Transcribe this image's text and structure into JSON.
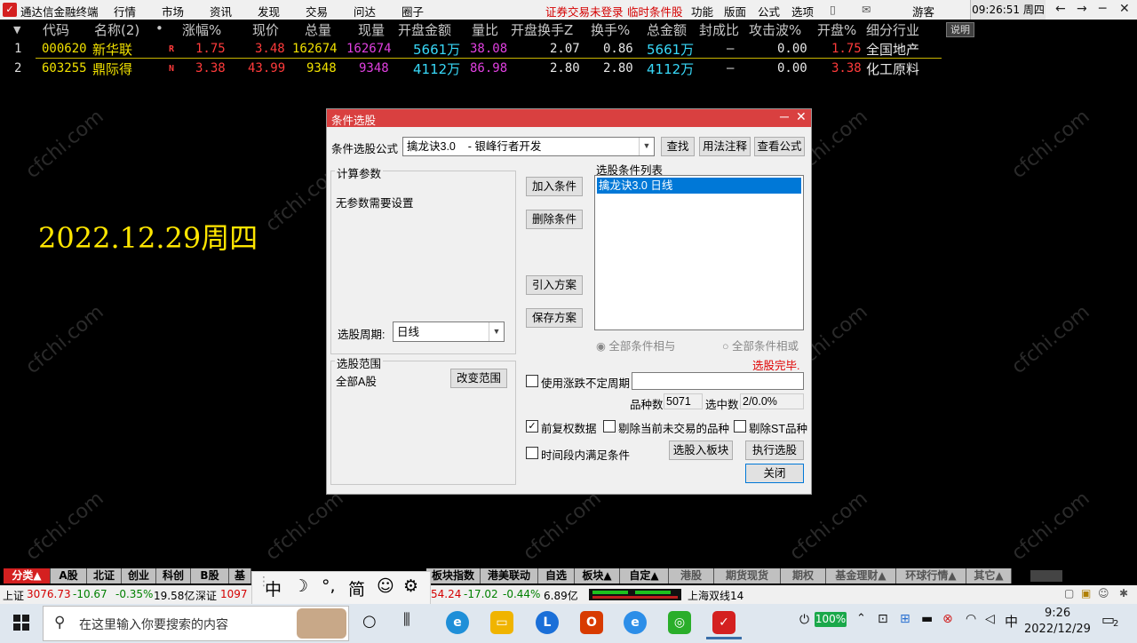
{
  "titlebar": {
    "app": "通达信金融终端",
    "menu": [
      "行情",
      "市场",
      "资讯",
      "发现",
      "交易",
      "问达",
      "圈子"
    ],
    "warn1": "证券交易未登录",
    "warn2": "临时条件股",
    "menu2": [
      "功能",
      "版面",
      "公式",
      "选项"
    ],
    "user": "游客",
    "clock": "09:26:51 周四",
    "win_buttons": [
      "←",
      "→",
      "─",
      "❐",
      "✕"
    ]
  },
  "table": {
    "headers": [
      "代码",
      "名称(2)",
      "•",
      "涨幅%",
      "现价",
      "总量",
      "现量",
      "开盘金额",
      "量比",
      "开盘换手Z",
      "换手%",
      "总金额",
      "封成比",
      "攻击波%",
      "开盘%",
      "细分行业"
    ],
    "explain": "说明",
    "rows": [
      {
        "no": "1",
        "code": "000620",
        "name": "新华联",
        "flag": "R",
        "chg": "1.75",
        "price": "3.48",
        "vol": "162674",
        "cur": "162674",
        "openamt": "5661万",
        "ratio": "38.08",
        "openturn": "2.07",
        "turn": "0.86",
        "amt": "5661万",
        "seal": "—",
        "atk": "0.00",
        "openpct": "1.75",
        "ind": "全国地产"
      },
      {
        "no": "2",
        "code": "603255",
        "name": "鼎际得",
        "flag": "N",
        "chg": "3.38",
        "price": "43.99",
        "vol": "9348",
        "cur": "9348",
        "openamt": "4112万",
        "ratio": "86.98",
        "openturn": "2.80",
        "turn": "2.80",
        "amt": "4112万",
        "seal": "—",
        "atk": "0.00",
        "openpct": "3.38",
        "ind": "化工原料"
      }
    ]
  },
  "date_overlay": "2022.12.29周四",
  "watermark": "cfchi.com",
  "dialog": {
    "title": "条件选股",
    "formula_label": "条件选股公式",
    "formula_value": "擒龙诀3.0    - 银峰行者开发",
    "btn_find": "查找",
    "btn_usage": "用法注释",
    "btn_view": "查看公式",
    "params_title": "计算参数",
    "params_text": "无参数需要设置",
    "period_label": "选股周期:",
    "period_value": "日线",
    "btn_add": "加入条件",
    "btn_del": "删除条件",
    "btn_import": "引入方案",
    "btn_save": "保存方案",
    "list_title": "选股条件列表",
    "list_item": "擒龙诀3.0  日线",
    "radio_and": "全部条件相与",
    "radio_or": "全部条件相或",
    "done": "选股完毕.",
    "range_title": "选股范围",
    "range_value": "全部A股",
    "btn_range": "改变范围",
    "cb_uncertain": "使用涨跌不定周期",
    "count_label": "品种数",
    "count_value": "5071",
    "hit_label": "选中数",
    "hit_value": "2/0.0%",
    "cb_fq": "前复权数据",
    "cb_notrade": "剔除当前未交易的品种",
    "cb_st": "剔除ST品种",
    "cb_period": "时间段内满足条件",
    "btn_toblock": "选股入板块",
    "btn_exec": "执行选股",
    "btn_close": "关闭"
  },
  "tabs": [
    "分类▲",
    "A股",
    "北证",
    "创业",
    "科创",
    "B股",
    "基",
    "",
    "板块指数",
    "港美联动",
    "自选",
    "板块▲",
    "自定▲",
    "港股",
    "期货现货",
    "期权",
    "基金理财▲",
    "环球行情▲",
    "其它▲"
  ],
  "ime": {
    "chars": [
      "中",
      "☽",
      "°,",
      "简",
      "☺",
      "⚙"
    ]
  },
  "status": {
    "sh_label": "上证",
    "sh_val": "3076.73",
    "sh_chg": "-10.67",
    "sh_pct": "-0.35%",
    "sh_amt": "19.58亿",
    "sz_label": "深证",
    "sz_val": "1097",
    "mid": "54.24",
    "mid_chg": "-17.02",
    "mid_pct": "-0.44%",
    "mid_amt": "6.89亿",
    "line": "上海双线14"
  },
  "taskbar": {
    "search_placeholder": "在这里输入你要搜索的内容",
    "battery": "100%",
    "ime": "中",
    "time": "9:26",
    "date": "2022/12/29",
    "notif": "2"
  },
  "colors": {
    "dialog_title": "#d94040",
    "accent_red": "#d42020",
    "yellow": "#f0e000"
  }
}
